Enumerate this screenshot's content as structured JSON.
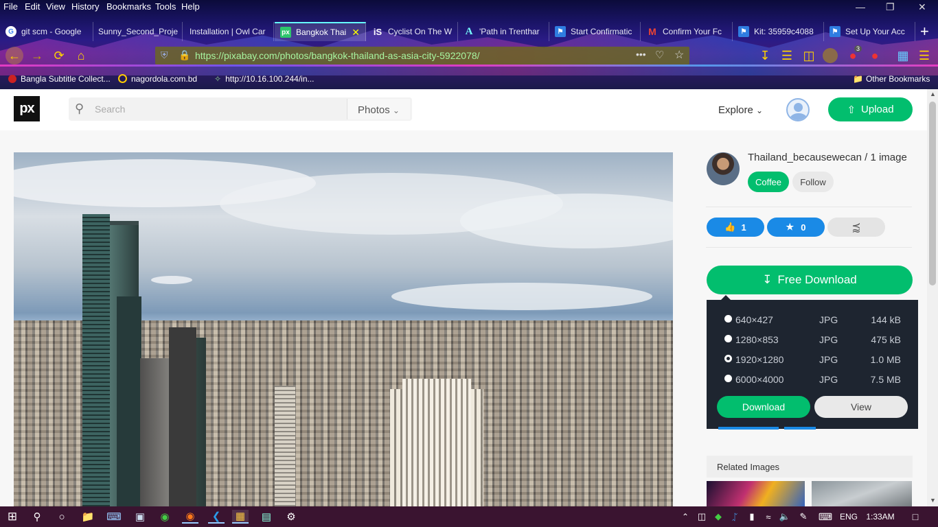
{
  "menubar": {
    "items": [
      "File",
      "Edit",
      "View",
      "History",
      "Bookmarks",
      "Tools",
      "Help"
    ]
  },
  "tabs": [
    {
      "title": "git scm - Google",
      "icon": "google-icon"
    },
    {
      "title": "Sunny_Second_Proje",
      "icon": "blank-icon"
    },
    {
      "title": "Installation | Owl Car",
      "icon": "blank-icon"
    },
    {
      "title": "Bangkok Thai",
      "icon": "pixabay-icon"
    },
    {
      "title": "Cyclist On The W",
      "icon": "istock-icon"
    },
    {
      "title": "'Path in Trenthar",
      "icon": "a-icon"
    },
    {
      "title": "Start Confirmatic",
      "icon": "flag-icon"
    },
    {
      "title": "Confirm Your Fc",
      "icon": "gmail-icon"
    },
    {
      "title": "Kit: 35959c4088",
      "icon": "flag-icon"
    },
    {
      "title": "Set Up Your Acc",
      "icon": "flag-icon"
    }
  ],
  "urlbar": {
    "url": "https://pixabay.com/photos/bangkok-thailand-as-asia-city-5922078/"
  },
  "toolbar": {
    "badge_count": "3"
  },
  "bookmarks": [
    {
      "label": "Bangla Subtitle Collect..."
    },
    {
      "label": "nagordola.com.bd"
    },
    {
      "label": "http://10.16.100.244/in..."
    }
  ],
  "bookmarks_other": "Other Bookmarks",
  "site": {
    "logo": "px",
    "search_placeholder": "Search",
    "search_type": "Photos",
    "explore": "Explore",
    "upload": "Upload"
  },
  "author": {
    "line": "Thailand_becausewecan / 1 image",
    "coffee": "Coffee",
    "follow": "Follow"
  },
  "actions": {
    "likes": "1",
    "favorites": "0"
  },
  "download": {
    "free_label": "Free Download",
    "options": [
      {
        "res": "640×427",
        "fmt": "JPG",
        "size": "144 kB",
        "selected": false
      },
      {
        "res": "1280×853",
        "fmt": "JPG",
        "size": "475 kB",
        "selected": false
      },
      {
        "res": "1920×1280",
        "fmt": "JPG",
        "size": "1.0 MB",
        "selected": true
      },
      {
        "res": "6000×4000",
        "fmt": "JPG",
        "size": "7.5 MB",
        "selected": false
      }
    ],
    "download_btn": "Download",
    "view_btn": "View"
  },
  "related": "Related Images",
  "taskbar": {
    "lang": "ENG",
    "time": "1:33AM"
  },
  "colors": {
    "brand_green": "#02be6e",
    "action_blue": "#1a8ae6",
    "panel_dark": "#1e2530"
  }
}
